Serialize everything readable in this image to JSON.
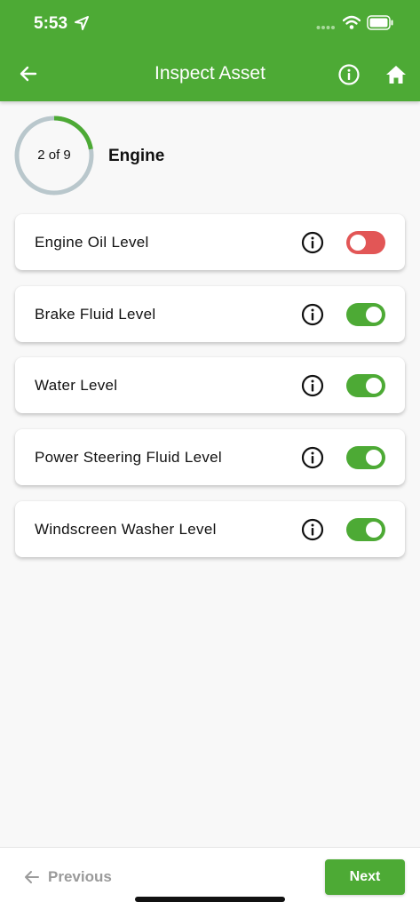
{
  "status_bar": {
    "time": "5:53"
  },
  "header": {
    "title": "Inspect Asset"
  },
  "progress": {
    "text": "2 of 9",
    "current": 2,
    "total": 9
  },
  "section": {
    "title": "Engine"
  },
  "items": [
    {
      "label": "Engine Oil Level",
      "on": false,
      "color": "#e25656"
    },
    {
      "label": "Brake Fluid Level",
      "on": true,
      "color": "#4daa35"
    },
    {
      "label": "Water Level",
      "on": true,
      "color": "#4daa35"
    },
    {
      "label": "Power Steering Fluid Level",
      "on": true,
      "color": "#4daa35"
    },
    {
      "label": "Windscreen Washer Level",
      "on": true,
      "color": "#4daa35"
    }
  ],
  "footer": {
    "previous_label": "Previous",
    "next_label": "Next"
  },
  "colors": {
    "brand": "#4daa35",
    "alert": "#e25656",
    "ring": "#b9c7cc"
  }
}
